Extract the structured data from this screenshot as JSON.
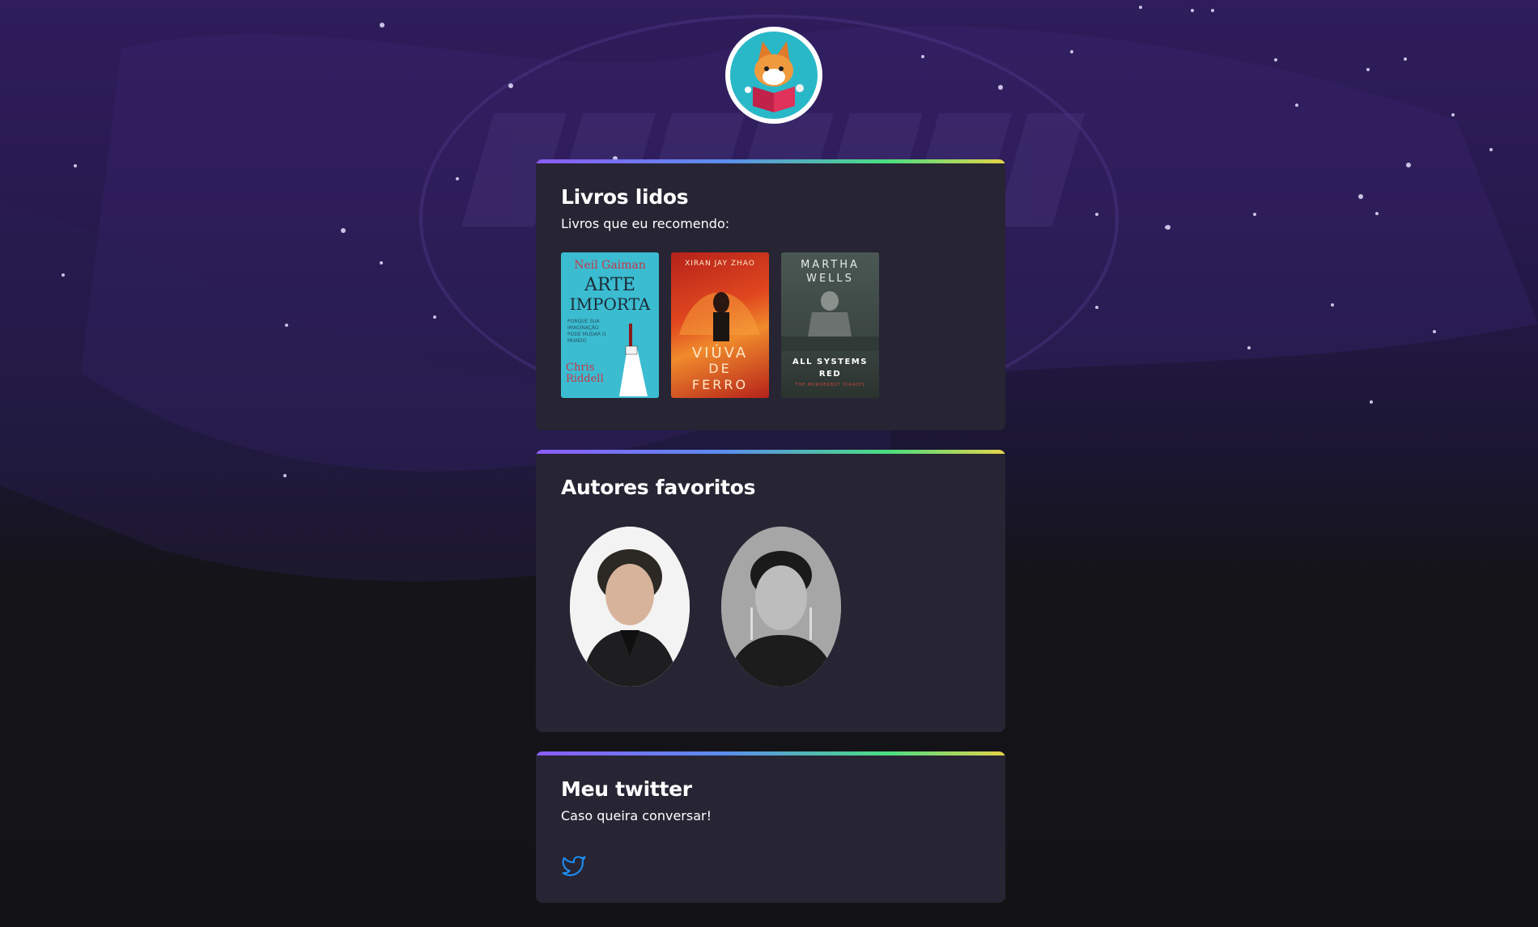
{
  "profile": {
    "avatar_icon": "cat-reading-book-avatar-icon"
  },
  "sections": {
    "books": {
      "title": "Livros lidos",
      "subtitle": "Livros que eu recomendo:",
      "items": [
        {
          "author": "Neil Gaiman",
          "title_line1": "ARTE",
          "title_line2": "IMPORTA",
          "tagline": "PORQUE SUA IMAGINAÇÃO PODE MUDAR O MUNDO",
          "illustrator": "Chris Riddell",
          "color": "#3bbcd0"
        },
        {
          "author": "XIRAN JAY ZHAO",
          "title_line1": "VIÚVA",
          "title_line2": "DE",
          "title_line3": "FERRO",
          "color": "#d13a1f"
        },
        {
          "author_line1": "MARTHA",
          "author_line2": "WELLS",
          "title_line1": "ALL SYSTEMS",
          "title_line2": "RED",
          "series": "THE MURDERBOT DIARIES",
          "color": "#3c4743"
        }
      ]
    },
    "authors": {
      "title": "Autores favoritos",
      "items": [
        {
          "photo": "neil-gaiman-photo"
        },
        {
          "photo": "xiran-jay-zhao-photo"
        }
      ]
    },
    "twitter": {
      "title": "Meu twitter",
      "subtitle": "Caso queira conversar!",
      "icon": "twitter-icon",
      "icon_color": "#1d8cf0"
    }
  },
  "colors": {
    "card_bg": "#272433",
    "accent_gradient": [
      "#8b5cf6",
      "#5b8def",
      "#4ade80",
      "#e5d34a"
    ]
  }
}
